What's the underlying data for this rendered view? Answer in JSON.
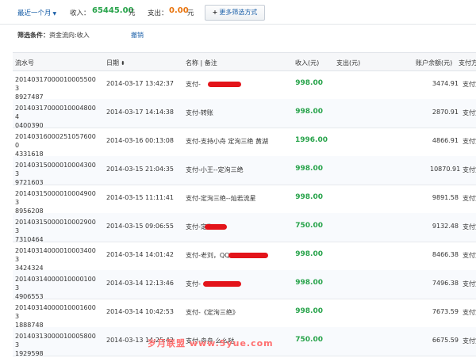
{
  "summary": {
    "period_label": "最近一个月",
    "income_label": "收入：",
    "income_value": "65445.00",
    "income_unit": "元",
    "expense_label": "支出：",
    "expense_value": "0.00",
    "expense_unit": "元",
    "more_filters": "更多筛选方式",
    "colors": {
      "income": "#27a34a",
      "expense": "#e8730c",
      "link": "#1a5fa8"
    }
  },
  "filter": {
    "label": "筛选条件：",
    "value": "资金流向:收入",
    "undo": "撤销"
  },
  "table": {
    "headers": {
      "serial": "流水号",
      "date": "日期",
      "name": "名称 | 备注",
      "income": "收入(元)",
      "expense": "支出(元)",
      "balance": "账户余额(元)",
      "channel": "支付方"
    },
    "rows": [
      {
        "serial": "20140317000010005500389 27487",
        "serial_l1": "20140317000010005500 3",
        "serial_l2": "8927487",
        "date": "2014-03-17 13:42:37",
        "name": "支付-",
        "income": "998.00",
        "balance": "3474.91",
        "channel": "支付宝"
      },
      {
        "serial_l1": "20140317000010004800 4",
        "serial_l2": "0400390",
        "date": "2014-03-17 14:14:38",
        "name": "支付-转账",
        "income": "998.00",
        "balance": "2870.91",
        "channel": "支付宝"
      },
      {
        "serial_l1": "20140316000251057600 0",
        "serial_l2": "4331618",
        "date": "2014-03-16 00:13:08",
        "name": "支付-支持小舟 定洵三绝 黄湖",
        "income": "1996.00",
        "balance": "4866.91",
        "channel": "支付宝"
      },
      {
        "serial_l1": "20140315000010004300 3",
        "serial_l2": "9721603",
        "date": "2014-03-15 21:04:35",
        "name": "支付-小王--定洵三绝",
        "income": "998.00",
        "balance": "10870.91",
        "channel": "支付宝"
      },
      {
        "serial_l1": "20140315000010004900 3",
        "serial_l2": "8956208",
        "date": "2014-03-15 11:11:41",
        "name": "支付-定洵三绝--灿若流星",
        "income": "998.00",
        "balance": "9891.58",
        "channel": "支付宝"
      },
      {
        "serial_l1": "20140315000010002900 3",
        "serial_l2": "7310464",
        "date": "2014-03-15 09:06:55",
        "name": "支付-定洵",
        "income": "750.00",
        "balance": "9132.48",
        "channel": "支付宝"
      },
      {
        "serial_l1": "20140314000010003400 3",
        "serial_l2": "3424324",
        "date": "2014-03-14 14:01:42",
        "name": "支付-老刘，QQ",
        "income": "998.00",
        "balance": "8466.38",
        "channel": "支付宝"
      },
      {
        "serial_l1": "20140314000010000100 3",
        "serial_l2": "4906553",
        "date": "2014-03-14 12:13:46",
        "name": "支付-",
        "income": "998.00",
        "balance": "7496.38",
        "channel": "支付宝"
      },
      {
        "serial_l1": "20140314000010001600 3",
        "serial_l2": "1888748",
        "date": "2014-03-14 10:42:53",
        "name": "支付-《定洵三绝》",
        "income": "998.00",
        "balance": "7673.59",
        "channel": "支付宝"
      },
      {
        "serial_l1": "20140313000010005800 3",
        "serial_l2": "1929598",
        "date": "2014-03-13 14:25:42",
        "name": "支付-舟舟 么么哒",
        "income": "750.00",
        "balance": "6675.59",
        "channel": "支付宝"
      }
    ]
  },
  "watermark": "岁月联盟 www.5yue.com"
}
